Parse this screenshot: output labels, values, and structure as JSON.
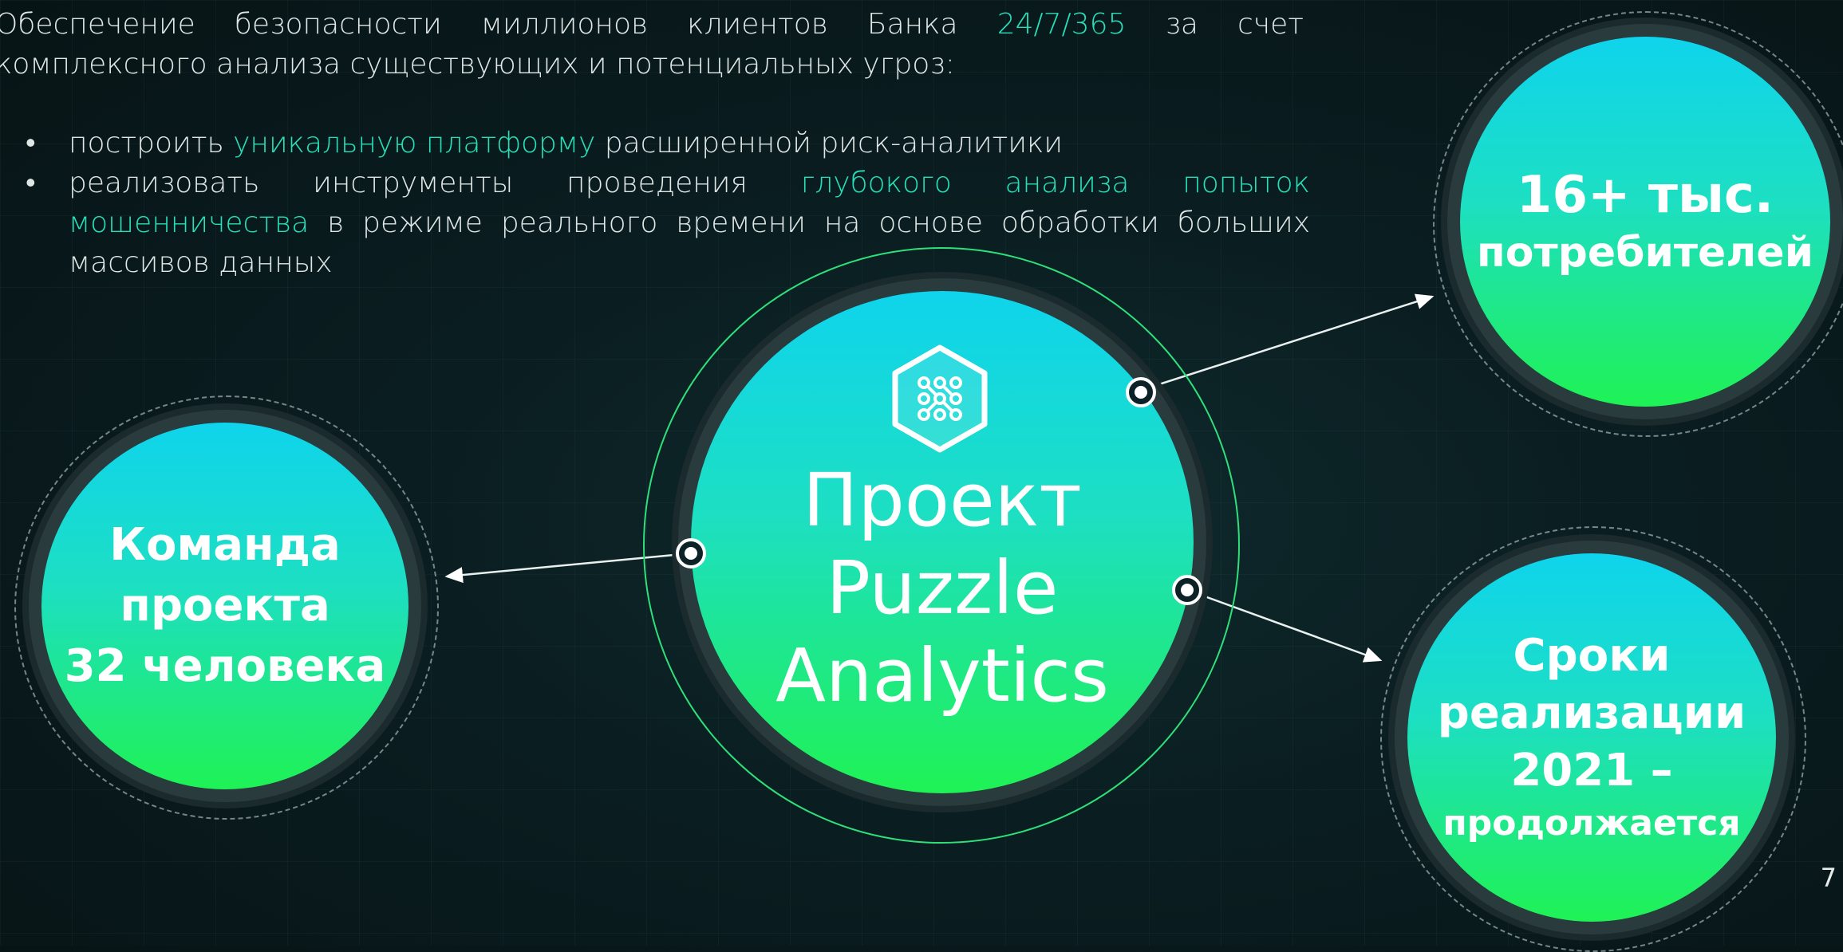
{
  "intro": {
    "before": "Обеспечение безопасности миллионов клиентов Банка ",
    "highlight": "24/7/365",
    "after": " за счет комплексного анализа существующих и потенциальных угроз:"
  },
  "bullets": [
    {
      "pre": "построить ",
      "accent": "уникальную платформу",
      "post": " расширенной риск-аналитики"
    },
    {
      "pre": "реализовать инструменты проведения ",
      "accent": "глубокого анализа попыток мошенничества",
      "post": " в режиме реального времени на основе обработки больших массивов данных"
    }
  ],
  "center": {
    "line1": "Проект",
    "line2": "Puzzle",
    "line3": "Analytics",
    "icon": "puzzle-analytics-logo-icon"
  },
  "left": {
    "line1": "Команда",
    "line2": "проекта",
    "line3": "32 человека"
  },
  "top_right": {
    "line1": "16+ тыс.",
    "line2": "потребителей"
  },
  "bottom_right": {
    "line1": "Сроки",
    "line2": "реализации",
    "line3": "2021 –",
    "line4": "продолжается"
  },
  "page_number": "7",
  "colors": {
    "accent": "#25e0b8",
    "circle_top": "#0fd4ec",
    "circle_bottom": "#1ff255",
    "ring": "#2ee07a"
  }
}
